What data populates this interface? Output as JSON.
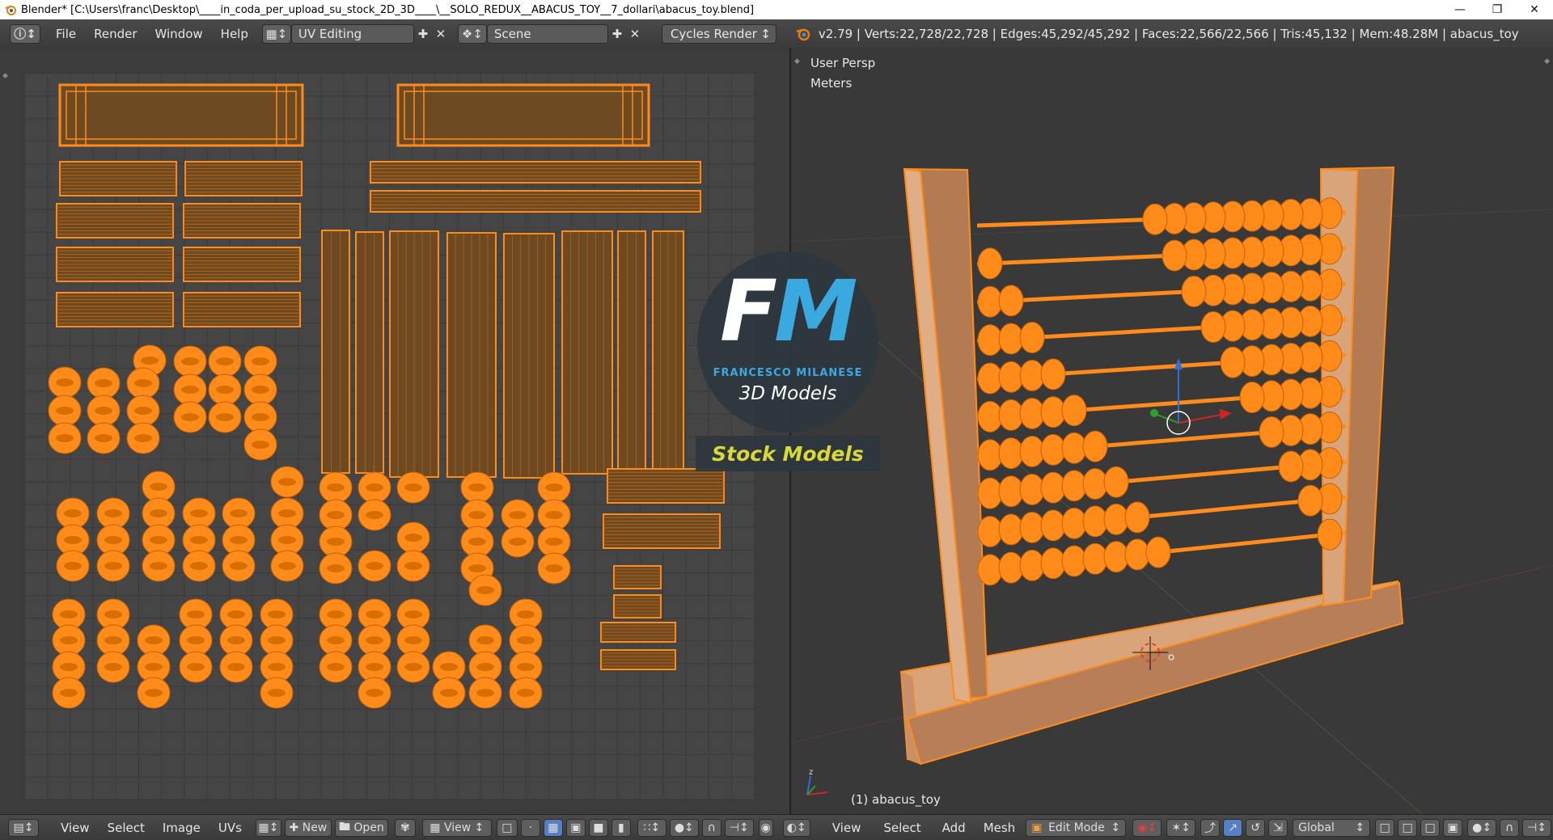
{
  "window": {
    "title": "Blender* [C:\\Users\\franc\\Desktop\\____in_coda_per_upload_su_stock_2D_3D____\\__SOLO_REDUX__ABACUS_TOY__7_dollari\\abacus_toy.blend]",
    "minimize_icon": "minimize-icon",
    "restore_icon": "restore-icon",
    "close_icon": "close-icon"
  },
  "info_header": {
    "menus": [
      "File",
      "Render",
      "Window",
      "Help"
    ],
    "screen_layout": "UV Editing",
    "scene": "Scene",
    "render_engine": "Cycles Render",
    "stats": "v2.79 | Verts:22,728/22,728 | Edges:45,292/45,292 | Faces:22,566/22,566 | Tris:45,132 | Mem:48.28M | abacus_toy"
  },
  "viewport": {
    "view_name": "User Persp",
    "units": "Meters",
    "object_label": "(1) abacus_toy"
  },
  "uv_header": {
    "menus": [
      "View",
      "Select",
      "Image",
      "UVs"
    ],
    "new_label": "New",
    "open_label": "Open",
    "view_label": "View"
  },
  "view3d_header": {
    "menus": [
      "View",
      "Select",
      "Add",
      "Mesh"
    ],
    "mode": "Edit Mode",
    "orientation": "Global"
  },
  "watermark": {
    "logo_f": "F",
    "logo_m": "M",
    "name": "FRANCESCO MILANESE",
    "subtitle": "3D Models",
    "banner": "Stock Models"
  },
  "colors": {
    "uv_orange": "#ff8c1a",
    "accent_blue": "#3aa9e0",
    "banner_yellow": "#d8d83a",
    "active_button": "#5680c2"
  }
}
